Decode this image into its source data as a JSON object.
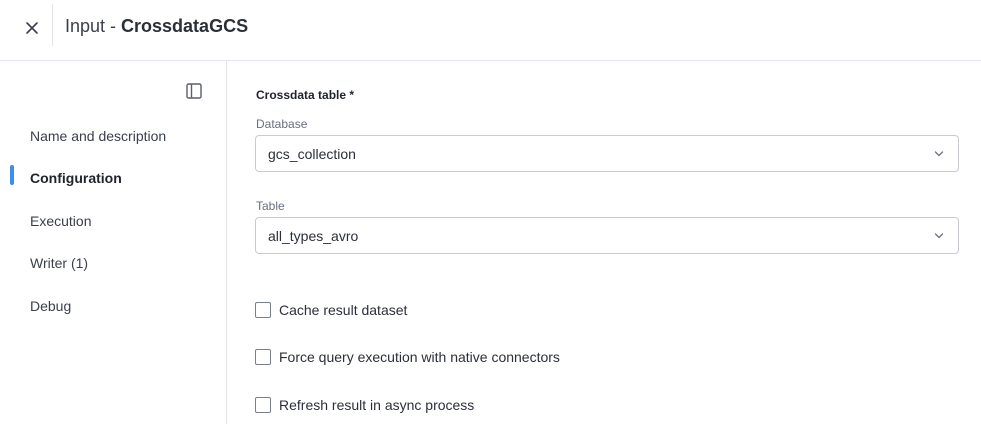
{
  "header": {
    "title_prefix": "Input - ",
    "title_name": "CrossdataGCS",
    "close_icon": "close-icon"
  },
  "sidebar": {
    "collapse_icon": "sidebar-panel-icon",
    "items": [
      {
        "label": "Name and description",
        "active": false
      },
      {
        "label": "Configuration",
        "active": true
      },
      {
        "label": "Execution",
        "active": false
      },
      {
        "label": "Writer (1)",
        "active": false
      },
      {
        "label": "Debug",
        "active": false
      }
    ],
    "accent_color": "#3b8ef0"
  },
  "main": {
    "section_title": "Crossdata table *",
    "database": {
      "label": "Database",
      "value": "gcs_collection"
    },
    "table": {
      "label": "Table",
      "value": "all_types_avro"
    },
    "options": [
      {
        "label": "Cache result dataset",
        "checked": false
      },
      {
        "label": "Force query execution with native connectors",
        "checked": false
      },
      {
        "label": "Refresh result in async process",
        "checked": false
      }
    ]
  }
}
